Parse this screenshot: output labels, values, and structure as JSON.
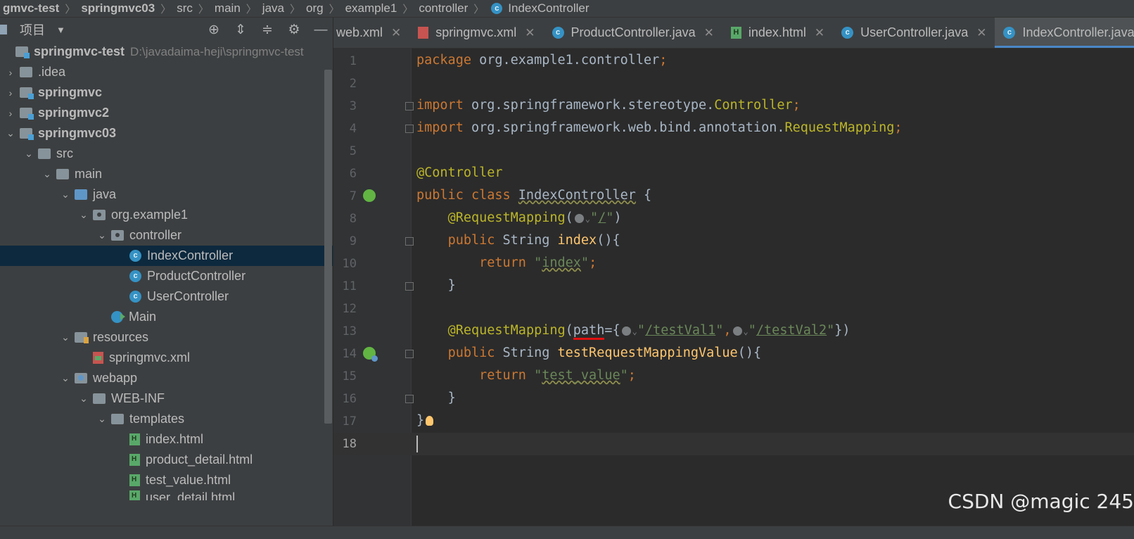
{
  "breadcrumb": [
    "gmvc-test",
    "springmvc03",
    "src",
    "main",
    "java",
    "org",
    "example1",
    "controller",
    "IndexController"
  ],
  "project_panel": {
    "title": "项目",
    "tools": [
      "crosshair-icon",
      "expand-all-icon",
      "collapse-all-icon",
      "gear-icon",
      "minimize-icon"
    ]
  },
  "tree": [
    {
      "label": "springmvc-test",
      "hint": "D:\\javadaima-heji\\springmvc-test",
      "icon": "module",
      "bold": true
    },
    {
      "label": ".idea",
      "icon": "folder",
      "arrow": ">"
    },
    {
      "label": "springmvc",
      "icon": "module",
      "arrow": ">",
      "bold": true
    },
    {
      "label": "springmvc2",
      "icon": "module",
      "arrow": ">",
      "bold": true
    },
    {
      "label": "springmvc03",
      "icon": "module",
      "arrow": "v",
      "bold": true
    },
    {
      "label": "src",
      "icon": "folder",
      "arrow": "v"
    },
    {
      "label": "main",
      "icon": "folder",
      "arrow": "v"
    },
    {
      "label": "java",
      "icon": "folder-blue",
      "arrow": "v"
    },
    {
      "label": "org.example1",
      "icon": "package",
      "arrow": "v"
    },
    {
      "label": "controller",
      "icon": "package",
      "arrow": "v"
    },
    {
      "label": "IndexController",
      "icon": "class",
      "selected": true
    },
    {
      "label": "ProductController",
      "icon": "class"
    },
    {
      "label": "UserController",
      "icon": "class"
    },
    {
      "label": "Main",
      "icon": "main-class"
    },
    {
      "label": "resources",
      "icon": "resources",
      "arrow": "v"
    },
    {
      "label": "springmvc.xml",
      "icon": "xml"
    },
    {
      "label": "webapp",
      "icon": "web",
      "arrow": "v"
    },
    {
      "label": "WEB-INF",
      "icon": "folder",
      "arrow": "v"
    },
    {
      "label": "templates",
      "icon": "folder",
      "arrow": "v"
    },
    {
      "label": "index.html",
      "icon": "html"
    },
    {
      "label": "product_detail.html",
      "icon": "html"
    },
    {
      "label": "test_value.html",
      "icon": "html"
    },
    {
      "label": "user_detail.html",
      "icon": "html"
    }
  ],
  "tabs": [
    {
      "label": "web.xml",
      "icon": "xml"
    },
    {
      "label": "springmvc.xml",
      "icon": "xml"
    },
    {
      "label": "ProductController.java",
      "icon": "class"
    },
    {
      "label": "index.html",
      "icon": "html"
    },
    {
      "label": "UserController.java",
      "icon": "class"
    },
    {
      "label": "IndexController.java",
      "icon": "class",
      "active": true
    }
  ],
  "code": {
    "line_numbers": [
      "1",
      "2",
      "3",
      "4",
      "5",
      "6",
      "7",
      "8",
      "9",
      "10",
      "11",
      "12",
      "13",
      "14",
      "15",
      "16",
      "17",
      "18"
    ],
    "l1_kw": "package",
    "l1_rest": " org.example1.controller",
    "l1_semi": ";",
    "l3_kw": "import",
    "l3_rest": " org.springframework.stereotype.",
    "l3_cls": "Controller",
    "l3_semi": ";",
    "l4_kw": "import",
    "l4_rest": " org.springframework.web.bind.annotation.",
    "l4_cls": "RequestMapping",
    "l4_semi": ";",
    "l6_ann": "@Controller",
    "l7_kw": "public class",
    "l7_cls": "IndexController",
    "l7_rest": " {",
    "l8_ann": "@RequestMapping",
    "l8_open": "(",
    "l8_q1": "\"",
    "l8_path": "/",
    "l8_q2": "\"",
    "l8_close": ")",
    "l9_kw": "public",
    "l9_type": " String ",
    "l9_fn": "index",
    "l9_rest": "(){",
    "l10_kw": "return",
    "l10_q1": " \"",
    "l10_val": "index",
    "l10_q2": "\"",
    "l10_semi": ";",
    "l11": "}",
    "l13_ann": "@RequestMapping",
    "l13_open": "(",
    "l13_attr": "path",
    "l13_eq": "={",
    "l13_q1": "\"",
    "l13_v1": "/testVal1",
    "l13_q2": "\"",
    "l13_comma": ",",
    "l13_q3": "\"",
    "l13_v2": "/testVal2",
    "l13_q4": "\"",
    "l13_close": "})",
    "l14_kw": "public",
    "l14_type": " String ",
    "l14_fn": "testRequestMappingValue",
    "l14_rest": "(){",
    "l15_kw": "return",
    "l15_q1": " \"",
    "l15_val": "test_value",
    "l15_q2": "\"",
    "l15_semi": ";",
    "l16": "}",
    "l17": "}"
  },
  "watermark": "CSDN @magic 245"
}
